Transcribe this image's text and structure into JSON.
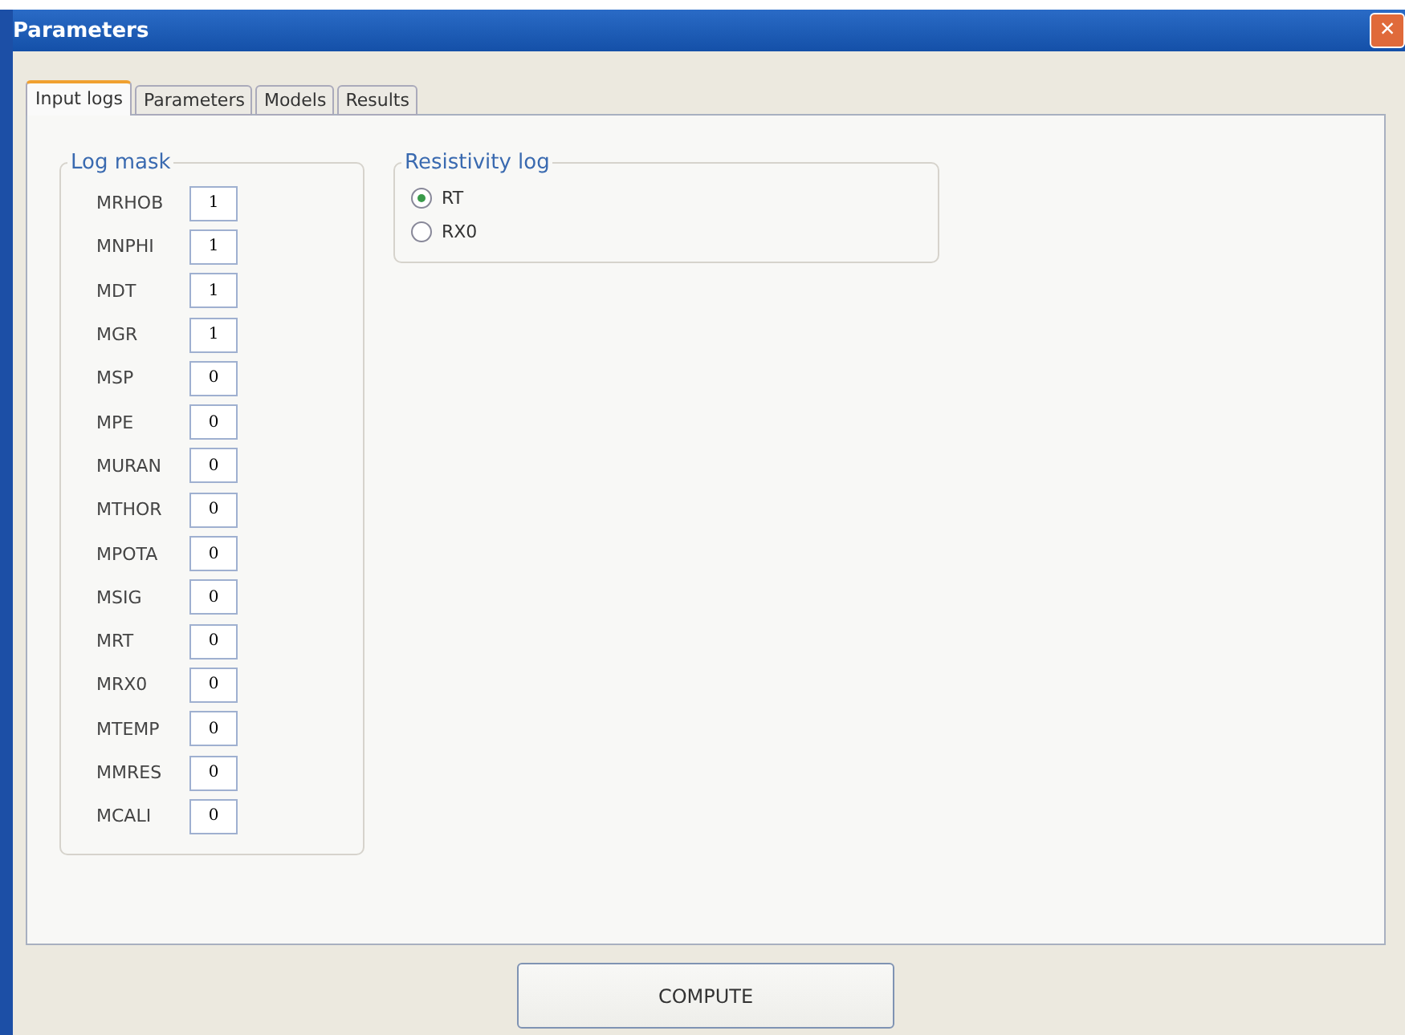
{
  "window": {
    "title": "Parameters",
    "close": "×"
  },
  "tabs": [
    {
      "label": "Input logs",
      "selected": true
    },
    {
      "label": "Parameters",
      "selected": false
    },
    {
      "label": "Models",
      "selected": false
    },
    {
      "label": "Results",
      "selected": false
    }
  ],
  "log_mask": {
    "title": "Log mask",
    "rows": [
      {
        "label": "MRHOB",
        "value": "1"
      },
      {
        "label": "MNPHI",
        "value": "1"
      },
      {
        "label": "MDT",
        "value": "1"
      },
      {
        "label": "MGR",
        "value": "1"
      },
      {
        "label": "MSP",
        "value": "0"
      },
      {
        "label": "MPE",
        "value": "0"
      },
      {
        "label": "MURAN",
        "value": "0"
      },
      {
        "label": "MTHOR",
        "value": "0"
      },
      {
        "label": "MPOTA",
        "value": "0"
      },
      {
        "label": "MSIG",
        "value": "0"
      },
      {
        "label": "MRT",
        "value": "0"
      },
      {
        "label": "MRX0",
        "value": "0"
      },
      {
        "label": "MTEMP",
        "value": "0"
      },
      {
        "label": "MMRES",
        "value": "0"
      },
      {
        "label": "MCALI",
        "value": "0"
      }
    ]
  },
  "resistivity_log": {
    "title": "Resistivity log",
    "options": [
      {
        "label": "RT",
        "selected": true
      },
      {
        "label": "RX0",
        "selected": false
      }
    ]
  },
  "compute_button": "COMPUTE"
}
